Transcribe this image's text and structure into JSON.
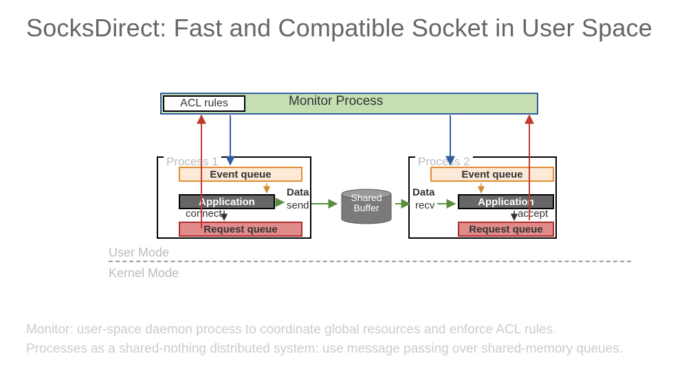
{
  "title": "SocksDirect: Fast and Compatible Socket in User Space",
  "monitor": {
    "acl": "ACL rules",
    "label": "Monitor Process"
  },
  "proc1": {
    "title": "Process 1",
    "event_queue": "Event queue",
    "application": "Application",
    "request_queue": "Request queue",
    "connect": "connect"
  },
  "proc2": {
    "title": "Process 2",
    "event_queue": "Event queue",
    "application": "Application",
    "request_queue": "Request queue",
    "accept": "accept"
  },
  "center": {
    "data1": "Data",
    "data2": "Data",
    "send": "send",
    "recv": "recv",
    "shared_buffer_l1": "Shared",
    "shared_buffer_l2": "Buffer"
  },
  "modes": {
    "user": "User Mode",
    "kernel": "Kernel Mode"
  },
  "footer": {
    "line1": "Monitor: user-space daemon process to coordinate global resources and enforce ACL rules.",
    "line2": "Processes as a shared-nothing distributed system: use message passing over shared-memory queues."
  }
}
